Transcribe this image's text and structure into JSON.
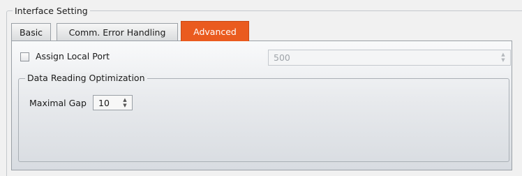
{
  "group": {
    "title": "Interface Setting"
  },
  "tabs": [
    {
      "label": "Basic",
      "active": false
    },
    {
      "label": "Comm. Error Handling",
      "active": false
    },
    {
      "label": "Advanced",
      "active": true
    }
  ],
  "advanced": {
    "assign_local_port": {
      "label": "Assign Local Port",
      "checked": false
    },
    "local_port": {
      "value": "500",
      "enabled": false
    },
    "optimization": {
      "title": "Data Reading Optimization",
      "maximal_gap": {
        "label": "Maximal Gap",
        "value": "10"
      }
    }
  },
  "colors": {
    "active_tab": "#ea5b1f",
    "panel_top": "#f9fafb",
    "panel_bottom": "#d8dce1"
  },
  "icons": {
    "spin_up": "▲",
    "spin_down": "▼"
  }
}
